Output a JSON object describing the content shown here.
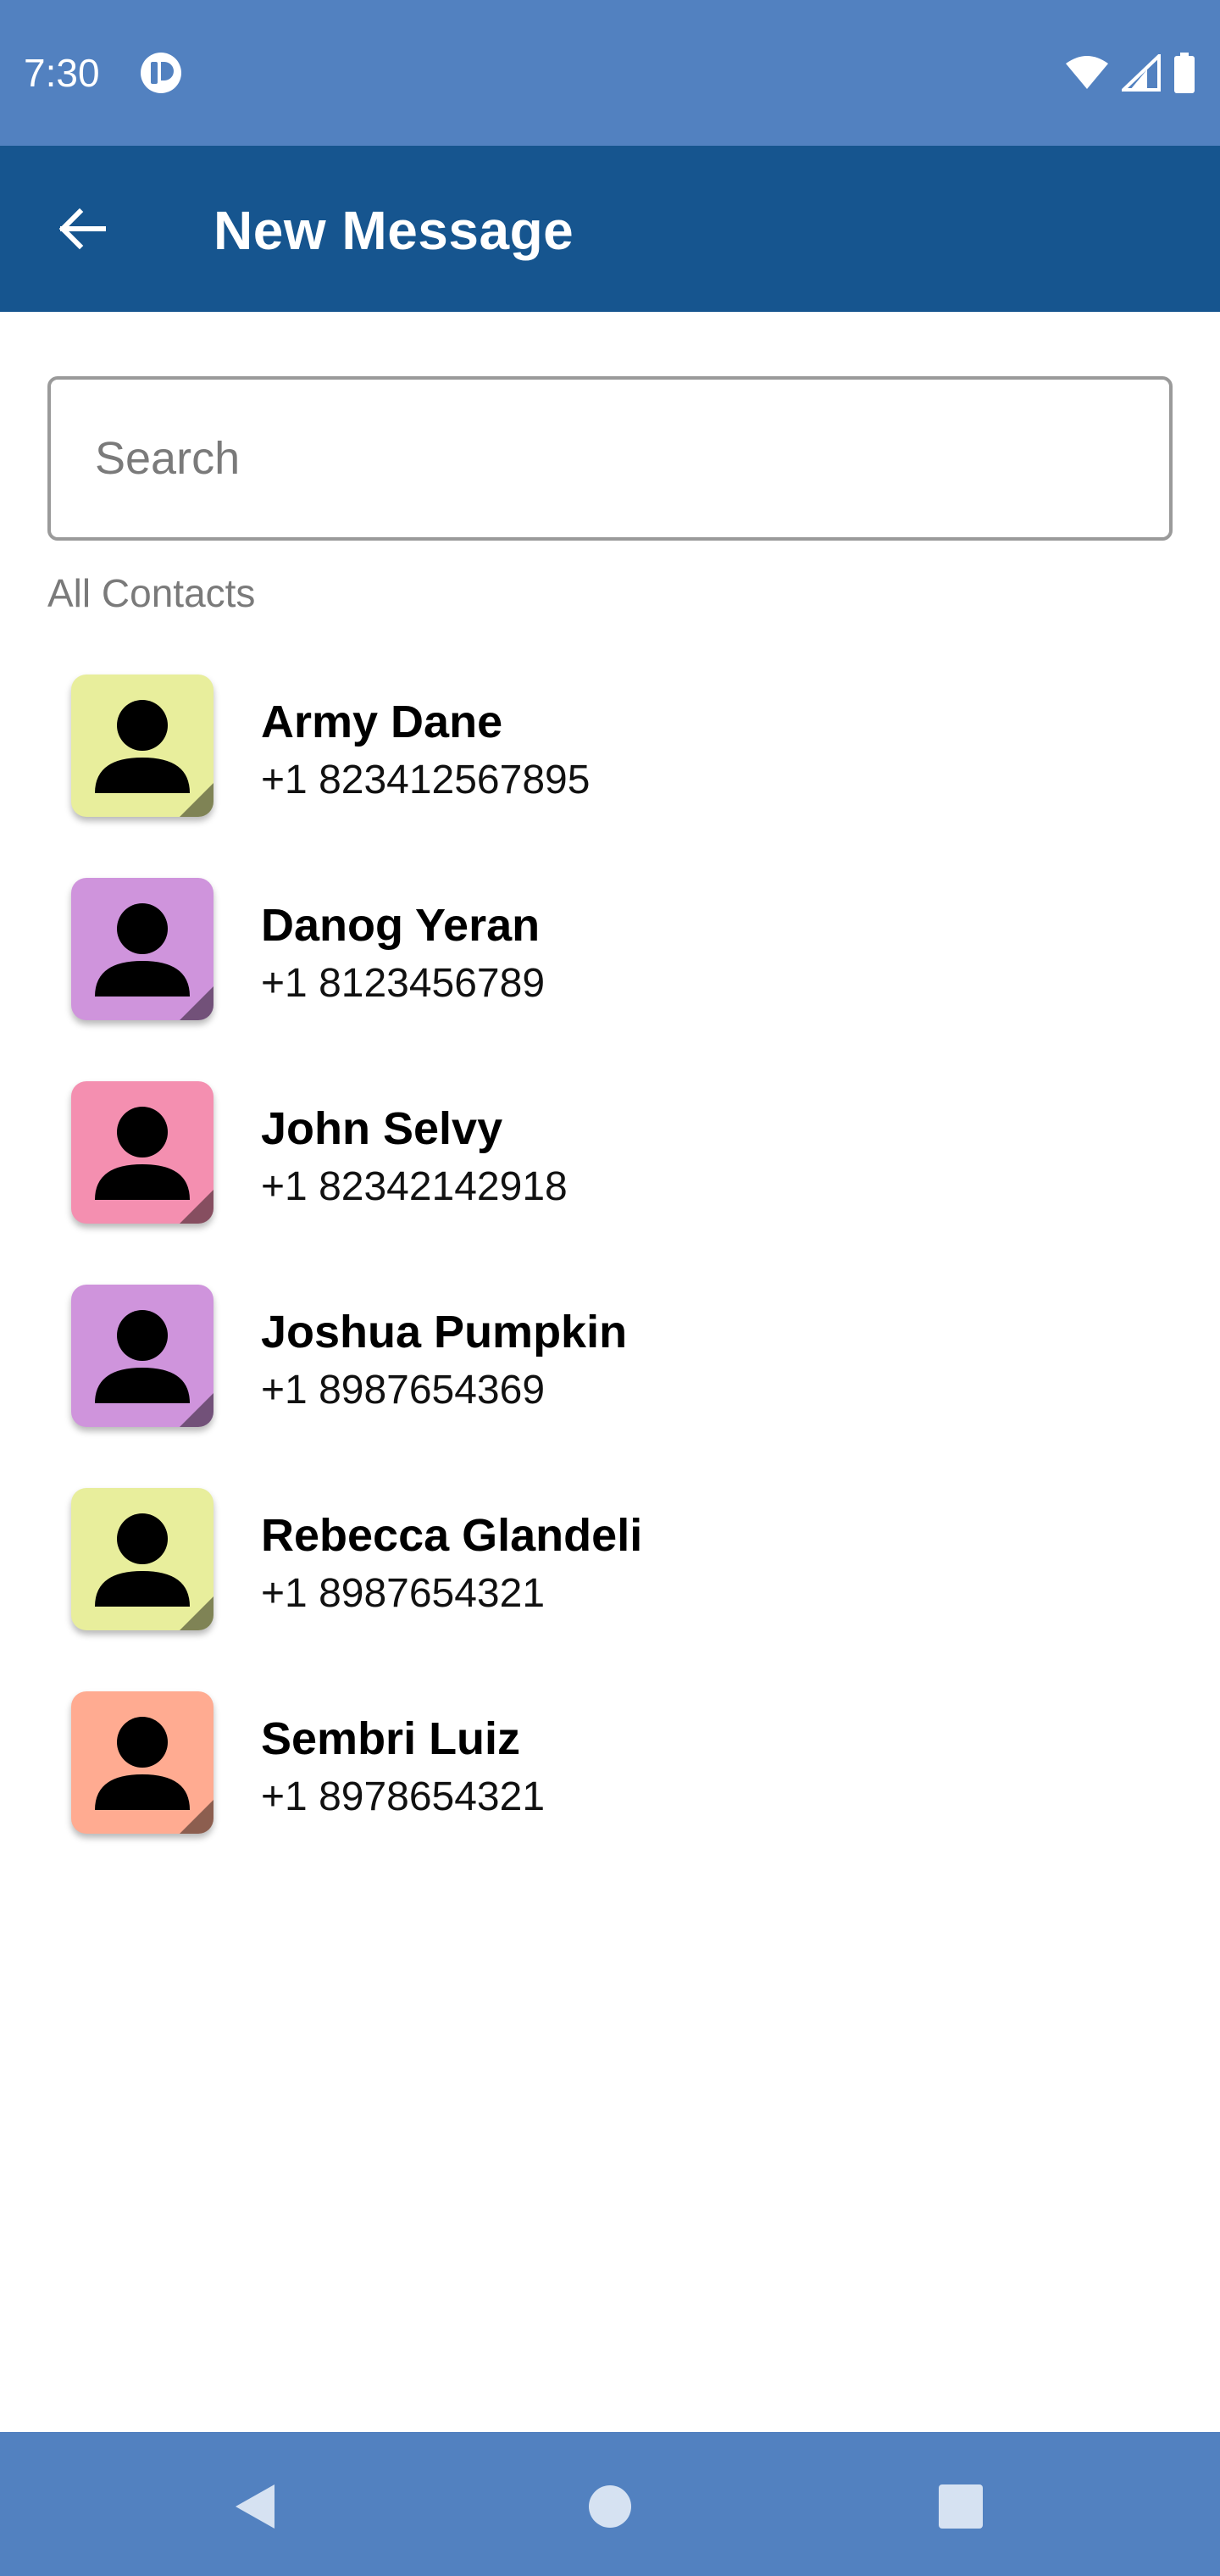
{
  "status_bar": {
    "time": "7:30",
    "icons": [
      "app-notification-icon",
      "wifi-icon",
      "signal-icon",
      "battery-icon"
    ]
  },
  "app_bar": {
    "title": "New Message",
    "back_icon": "arrow-back-icon"
  },
  "search": {
    "placeholder": "Search",
    "value": ""
  },
  "contacts_section": {
    "label": "All Contacts",
    "items": [
      {
        "name": "Army Dane",
        "phone": "+1 823412567895",
        "avatar_color": "#e8ee9c"
      },
      {
        "name": "Danog Yeran",
        "phone": "+1 8123456789",
        "avatar_color": "#cf94dc"
      },
      {
        "name": "John Selvy",
        "phone": "+1 82342142918",
        "avatar_color": "#f48fb0"
      },
      {
        "name": "Joshua Pumpkin",
        "phone": "+1 8987654369",
        "avatar_color": "#cf94dc"
      },
      {
        "name": "Rebecca Glandeli",
        "phone": "+1 8987654321",
        "avatar_color": "#e8ee9c"
      },
      {
        "name": "Sembri Luiz",
        "phone": "+1 8978654321",
        "avatar_color": "#ffab91"
      }
    ]
  },
  "nav_bar": {
    "buttons": [
      "nav-back-icon",
      "nav-home-icon",
      "nav-recents-icon"
    ]
  },
  "colors": {
    "status_bar": "#5281c0",
    "app_bar": "#16558f",
    "nav_bar": "#5281c0"
  }
}
